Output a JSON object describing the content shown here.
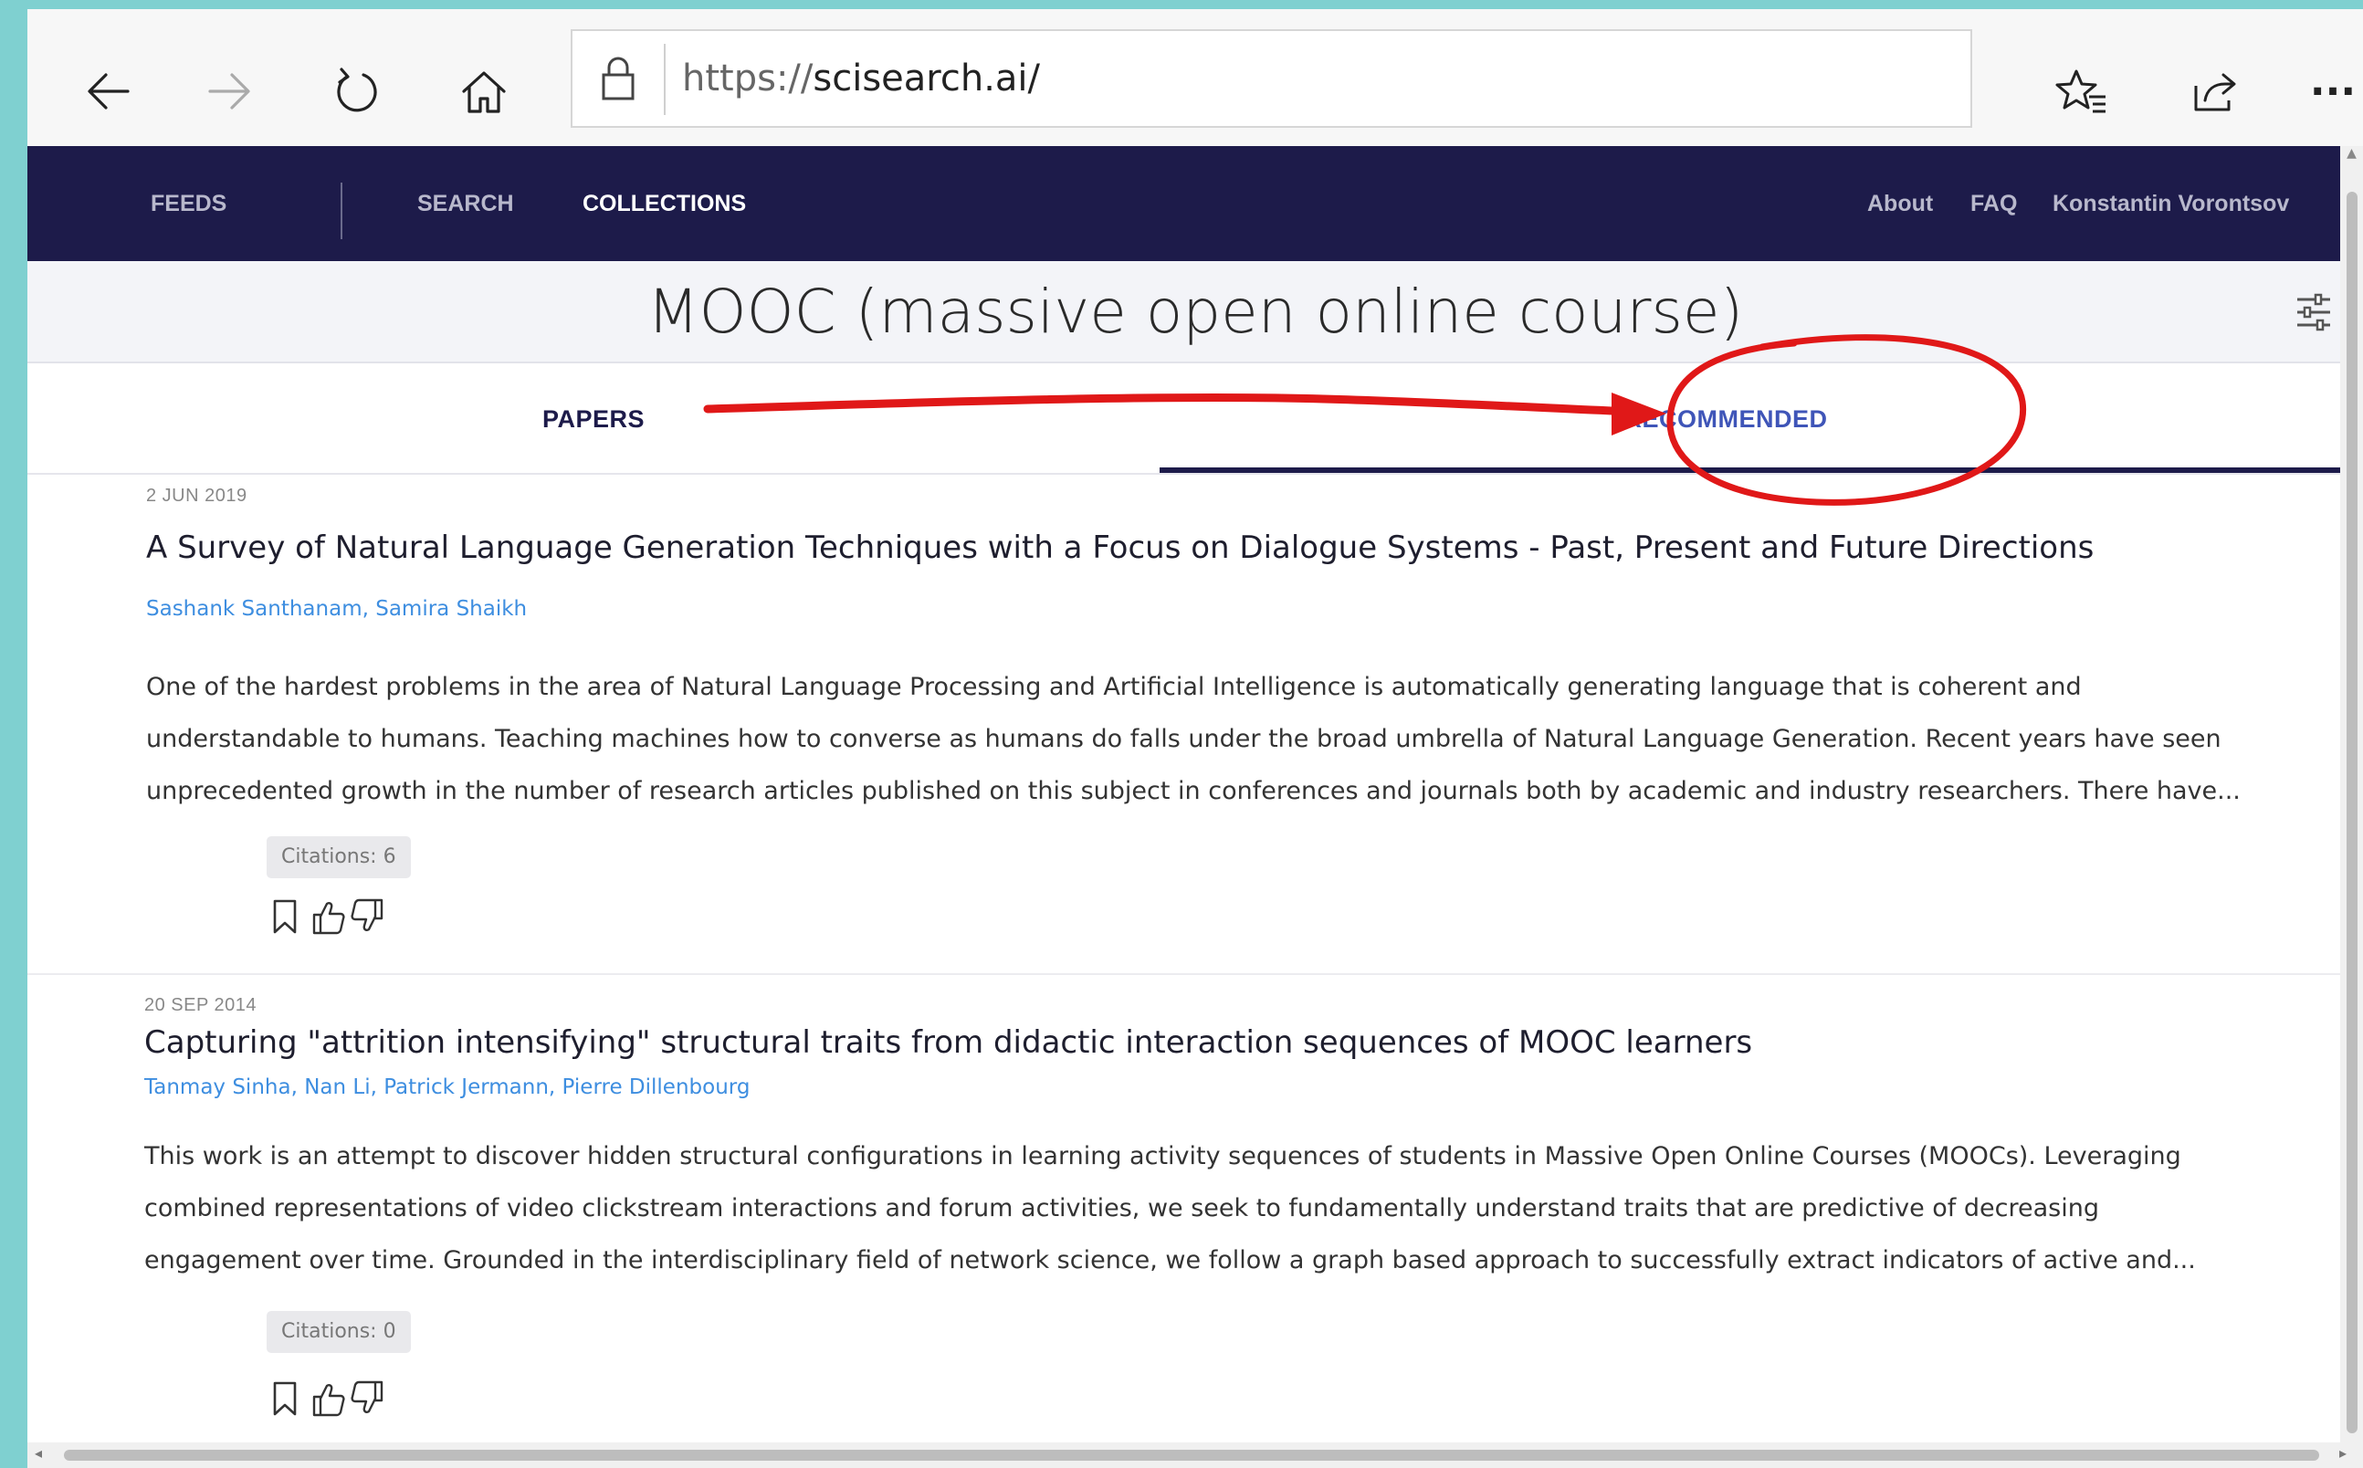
{
  "browser": {
    "url_prefix": "https://",
    "url_host": "scisearch.ai/",
    "toolbar_icons": [
      "back-icon",
      "forward-icon",
      "refresh-icon",
      "home-icon",
      "lock-icon",
      "favorites-icon",
      "share-icon",
      "more-icon"
    ],
    "more_label": "···"
  },
  "nav": {
    "feeds": "FEEDS",
    "search": "SEARCH",
    "collections": "COLLECTIONS",
    "about": "About",
    "faq": "FAQ",
    "user": "Konstantin Vorontsov"
  },
  "collection": {
    "title": "MOOC (massive open online course)"
  },
  "tabs": {
    "papers": "PAPERS",
    "recommended": "RECOMMENDED",
    "active": "recommended"
  },
  "papers": [
    {
      "date": "2 JUN 2019",
      "title": "A Survey of Natural Language Generation Techniques with a Focus on Dialogue Systems - Past, Present and Future Directions",
      "authors": "Sashank Santhanam, Samira Shaikh",
      "abstract_lines": [
        "One of the hardest problems in the area of Natural Language Processing and Artificial Intelligence is automatically generating language that is coherent and",
        "understandable to humans. Teaching machines how to converse as humans do falls under the broad umbrella of Natural Language Generation. Recent years have seen",
        "unprecedented growth in the number of research articles published on this subject in conferences and journals both by academic and industry researchers. There have..."
      ],
      "citations": "Citations: 6"
    },
    {
      "date": "20 SEP 2014",
      "title": "Capturing \"attrition intensifying\" structural traits from didactic interaction sequences of MOOC learners",
      "authors": "Tanmay Sinha, Nan Li, Patrick Jermann, Pierre Dillenbourg",
      "abstract_lines": [
        "This work is an attempt to discover hidden structural configurations in learning activity sequences of students in Massive Open Online Courses (MOOCs). Leveraging",
        "combined representations of video clickstream interactions and forum activities, we seek to fundamentally understand traits that are predictive of decreasing",
        "engagement over time. Grounded in the interdisciplinary field of network science, we follow a graph based approach to successfully extract indicators of active and..."
      ],
      "citations": "Citations: 0"
    }
  ],
  "colors": {
    "nav_bg": "#1d1b4a",
    "accent_blue": "#3f55b8",
    "author_link": "#3e8ee0",
    "annotation_red": "#e01818"
  }
}
